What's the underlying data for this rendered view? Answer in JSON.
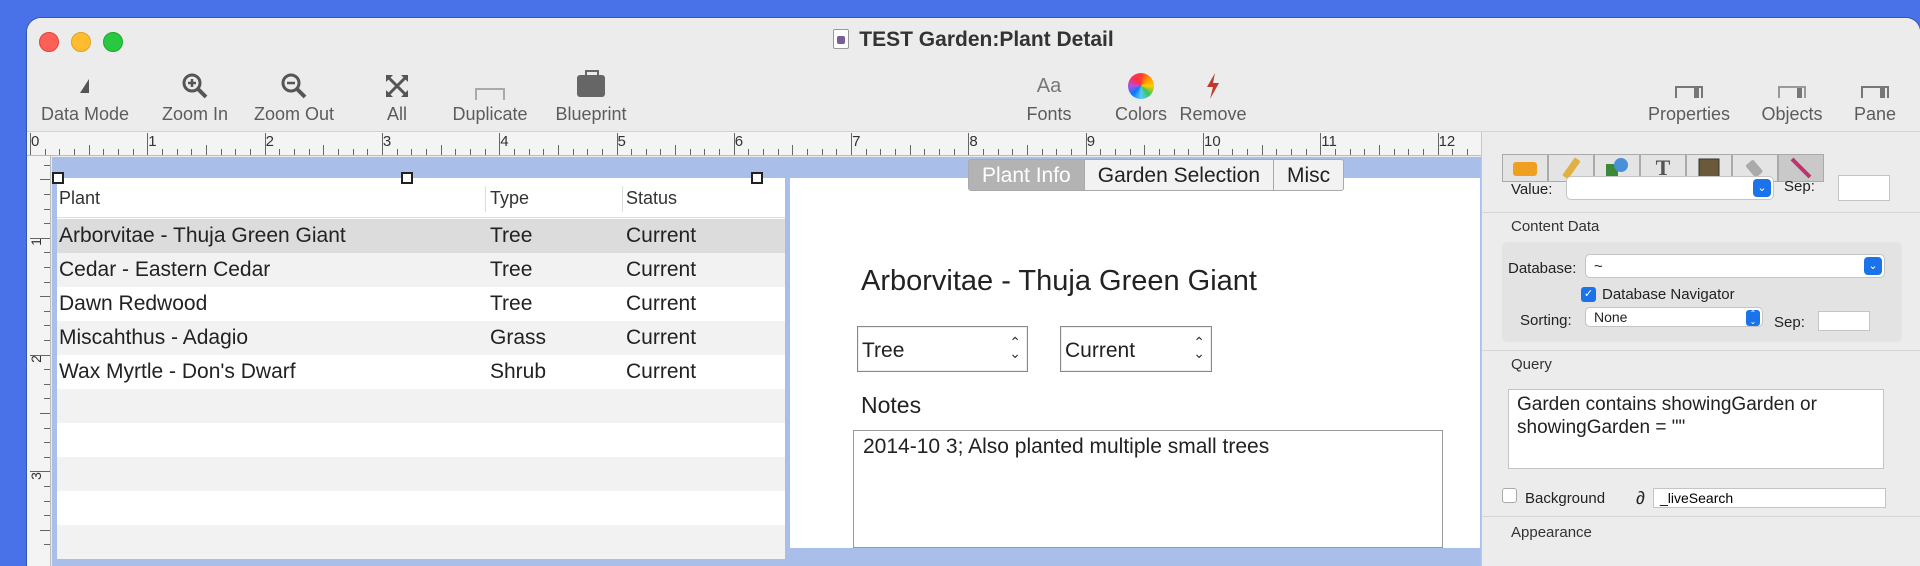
{
  "window": {
    "title": "TEST Garden:Plant Detail"
  },
  "toolbar": {
    "left": [
      {
        "label": "Data Mode",
        "icon": "pointer-icon"
      },
      {
        "label": "Zoom In",
        "icon": "zoom-in-icon"
      },
      {
        "label": "Zoom Out",
        "icon": "zoom-out-icon"
      },
      {
        "label": "All",
        "icon": "expand-icon"
      },
      {
        "label": "Duplicate",
        "icon": "duplicate-icon"
      },
      {
        "label": "Blueprint",
        "icon": "briefcase-icon"
      }
    ],
    "center": [
      {
        "label": "Fonts",
        "glyph": "Aa"
      },
      {
        "label": "Colors",
        "icon": "color-wheel-icon"
      },
      {
        "label": "Remove",
        "icon": "lightning-icon"
      }
    ],
    "right": [
      {
        "label": "Properties"
      },
      {
        "label": "Objects"
      },
      {
        "label": "Pane"
      }
    ]
  },
  "ruler": {
    "h_numbers": [
      "0",
      "1",
      "2",
      "3",
      "4",
      "5",
      "6",
      "7",
      "8",
      "9",
      "10",
      "11",
      "12"
    ],
    "v_numbers": [
      "1",
      "2",
      "3"
    ]
  },
  "list": {
    "columns": [
      "Plant",
      "Type",
      "Status"
    ],
    "rows": [
      [
        "Arborvitae - Thuja Green Giant",
        "Tree",
        "Current"
      ],
      [
        "Cedar - Eastern Cedar",
        "Tree",
        "Current"
      ],
      [
        "Dawn Redwood",
        "Tree",
        "Current"
      ],
      [
        "Miscahthus - Adagio",
        "Grass",
        "Current"
      ],
      [
        "Wax Myrtle - Don's Dwarf",
        "Shrub",
        "Current"
      ]
    ]
  },
  "detail": {
    "tabs": [
      "Plant Info",
      "Garden Selection",
      "Misc"
    ],
    "active_tab": "Plant Info",
    "plant_name": "Arborvitae - Thuja Green Giant",
    "type_value": "Tree",
    "status_value": "Current",
    "notes_label": "Notes",
    "notes_value": "2014-10 3; Also planted multiple small trees"
  },
  "inspector": {
    "value_label": "Value:",
    "sep_label": "Sep:",
    "content_data_title": "Content Data",
    "database_label": "Database:",
    "database_value": "~",
    "navigator_label": "Database Navigator",
    "sorting_label": "Sorting:",
    "sorting_value": "None",
    "query_title": "Query",
    "query_text": "Garden contains showingGarden or showingGarden = \"\"",
    "background_label": "Background",
    "live_search_symbol": "∂",
    "live_search_value": "_liveSearch",
    "appearance_title": "Appearance"
  },
  "colors": {
    "desktop": "#4a72e8",
    "canvas": "#a9bfe9",
    "accent": "#1a73e8"
  }
}
